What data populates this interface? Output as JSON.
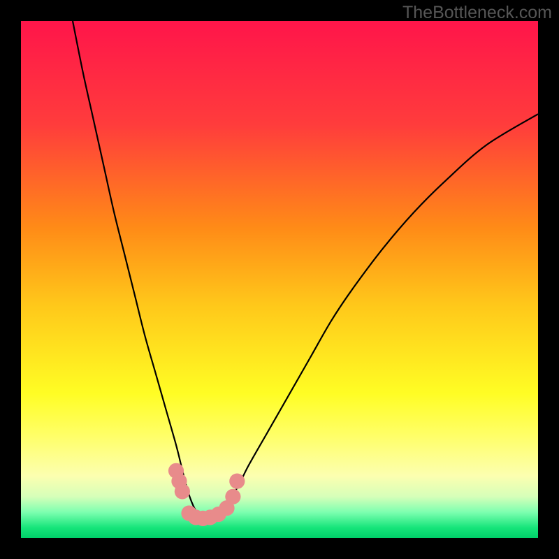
{
  "watermark": "TheBottleneck.com",
  "chart_data": {
    "type": "line",
    "title": "",
    "xlabel": "",
    "ylabel": "",
    "xlim": [
      0,
      100
    ],
    "ylim": [
      0,
      100
    ],
    "gradient_stops": [
      {
        "pos": 0.0,
        "color": "#ff154a"
      },
      {
        "pos": 0.2,
        "color": "#ff3c3c"
      },
      {
        "pos": 0.4,
        "color": "#ff8b17"
      },
      {
        "pos": 0.55,
        "color": "#ffc81a"
      },
      {
        "pos": 0.72,
        "color": "#fffd24"
      },
      {
        "pos": 0.8,
        "color": "#ffff66"
      },
      {
        "pos": 0.88,
        "color": "#fcffb0"
      },
      {
        "pos": 0.92,
        "color": "#d6ffb9"
      },
      {
        "pos": 0.95,
        "color": "#7dffb0"
      },
      {
        "pos": 0.98,
        "color": "#16e57a"
      },
      {
        "pos": 1.0,
        "color": "#00d069"
      }
    ],
    "series": [
      {
        "name": "bottleneck-curve",
        "color": "#000000",
        "x": [
          10,
          12,
          14,
          16,
          18,
          20,
          22,
          24,
          26,
          28,
          30,
          31,
          32,
          33,
          34,
          35,
          36,
          38,
          40,
          42,
          44,
          48,
          52,
          56,
          60,
          64,
          70,
          76,
          82,
          90,
          100
        ],
        "y": [
          100,
          90,
          81,
          72,
          63,
          55,
          47,
          39,
          32,
          25,
          18,
          14,
          10,
          7,
          5,
          4,
          4,
          5,
          7,
          10,
          14,
          21,
          28,
          35,
          42,
          48,
          56,
          63,
          69,
          76,
          82
        ]
      }
    ],
    "markers": {
      "name": "highlight-dots",
      "shape": "circle",
      "color": "#e88b8b",
      "radius_pct": 1.5,
      "points": [
        {
          "x": 30.0,
          "y": 13.0
        },
        {
          "x": 30.6,
          "y": 11.0
        },
        {
          "x": 31.2,
          "y": 9.0
        },
        {
          "x": 32.5,
          "y": 4.8
        },
        {
          "x": 33.8,
          "y": 4.0
        },
        {
          "x": 35.2,
          "y": 3.8
        },
        {
          "x": 36.6,
          "y": 4.0
        },
        {
          "x": 38.2,
          "y": 4.6
        },
        {
          "x": 39.8,
          "y": 5.8
        },
        {
          "x": 41.0,
          "y": 8.0
        },
        {
          "x": 41.8,
          "y": 11.0
        }
      ]
    }
  }
}
